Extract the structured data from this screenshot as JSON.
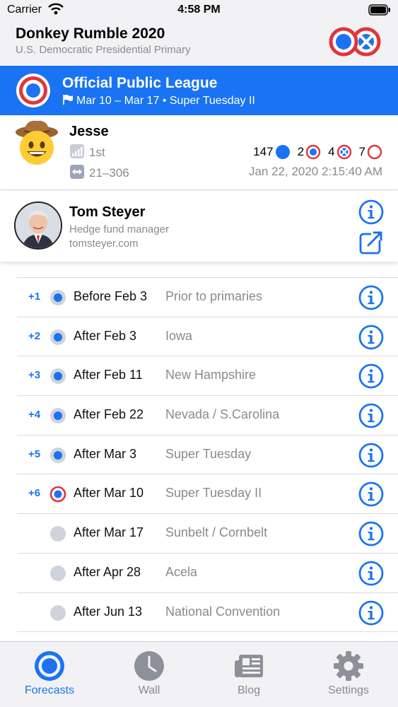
{
  "status": {
    "carrier": "Carrier",
    "time": "4:58 PM"
  },
  "header": {
    "title": "Donkey Rumble 2020",
    "subtitle": "U.S. Democratic Presidential Primary"
  },
  "league": {
    "title": "Official Public League",
    "subtitle": "Mar 10 – Mar 17 • Super Tuesday II"
  },
  "user": {
    "name": "Jesse",
    "rank": "1st",
    "range": "21–306",
    "stats": [
      {
        "value": "147",
        "icon": "solid-dot-icon"
      },
      {
        "value": "2",
        "icon": "target-icon"
      },
      {
        "value": "4",
        "icon": "crossed-circle-icon"
      },
      {
        "value": "7",
        "icon": "empty-red-circle-icon"
      }
    ],
    "timestamp": "Jan 22, 2020 2:15:40 AM"
  },
  "candidate": {
    "name": "Tom Steyer",
    "occupation": "Hedge fund manager",
    "website": "tomsteyer.com"
  },
  "timeline": [
    {
      "delta": "+1",
      "date": "Before Feb 3",
      "event": "Prior to primaries",
      "status": "done"
    },
    {
      "delta": "+2",
      "date": "After Feb 3",
      "event": "Iowa",
      "status": "done"
    },
    {
      "delta": "+3",
      "date": "After Feb 11",
      "event": "New Hampshire",
      "status": "done"
    },
    {
      "delta": "+4",
      "date": "After Feb 22",
      "event": "Nevada / S.Carolina",
      "status": "done"
    },
    {
      "delta": "+5",
      "date": "After Mar 3",
      "event": "Super Tuesday",
      "status": "done"
    },
    {
      "delta": "+6",
      "date": "After Mar 10",
      "event": "Super Tuesday II",
      "status": "current"
    },
    {
      "delta": "",
      "date": "After Mar 17",
      "event": "Sunbelt / Cornbelt",
      "status": "future"
    },
    {
      "delta": "",
      "date": "After Apr 28",
      "event": "Acela",
      "status": "future"
    },
    {
      "delta": "",
      "date": "After Jun 13",
      "event": "National Convention",
      "status": "future"
    }
  ],
  "tabs": [
    {
      "label": "Forecasts",
      "icon": "forecasts-icon",
      "active": true
    },
    {
      "label": "Wall",
      "icon": "clock-icon",
      "active": false
    },
    {
      "label": "Blog",
      "icon": "newspaper-icon",
      "active": false
    },
    {
      "label": "Settings",
      "icon": "gear-icon",
      "active": false
    }
  ],
  "colors": {
    "accent": "#1a73f2",
    "red": "#e2353a",
    "gray": "#8a8a8f"
  }
}
